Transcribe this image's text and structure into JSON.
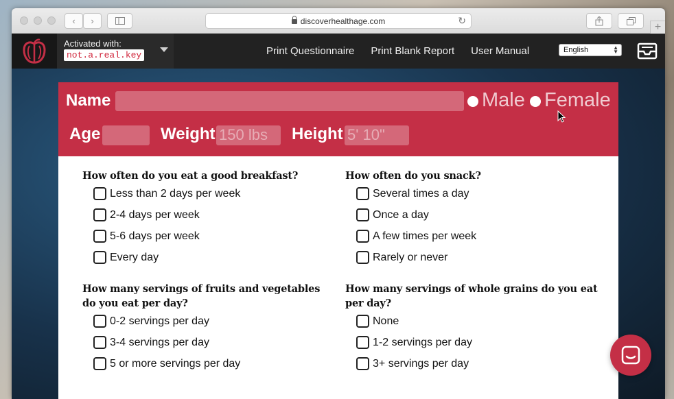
{
  "browser": {
    "url": "discoverhealthage.com"
  },
  "header": {
    "activated_label": "Activated with:",
    "license_key": "not.a.real.key",
    "nav": [
      "Print Questionnaire",
      "Print Blank Report",
      "User Manual"
    ],
    "language": "English"
  },
  "form": {
    "name_label": "Name",
    "name_value": "",
    "gender_options": [
      "Male",
      "Female"
    ],
    "age_label": "Age",
    "age_value": "",
    "weight_label": "Weight",
    "weight_placeholder": "150 lbs",
    "height_label": "Height",
    "height_placeholder": "5' 10\""
  },
  "questions": [
    {
      "title": "How often do you eat a good breakfast?",
      "options": [
        "Less than 2 days per week",
        "2-4 days per week",
        "5-6 days per week",
        "Every day"
      ]
    },
    {
      "title": "How often do you snack?",
      "options": [
        "Several times a day",
        "Once a day",
        "A few times per week",
        "Rarely or never"
      ]
    },
    {
      "title": "How many servings of fruits and vegetables do you eat per day?",
      "options": [
        "0-2 servings per day",
        "3-4 servings per day",
        "5 or more servings per day"
      ]
    },
    {
      "title": "How many servings of whole grains do you eat per day?",
      "options": [
        "None",
        "1-2 servings per day",
        "3+ servings per day"
      ]
    }
  ],
  "colors": {
    "brand_red": "#c42f46",
    "header_dark": "#222222"
  }
}
